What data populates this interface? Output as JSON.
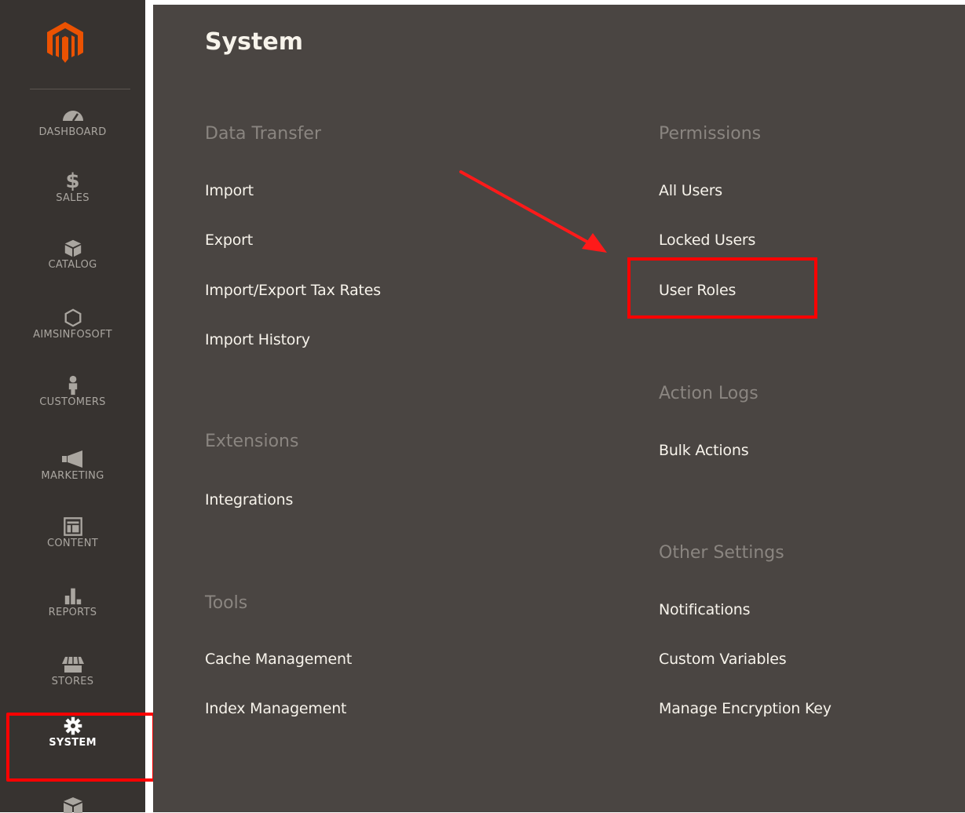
{
  "sidebar": {
    "items": [
      {
        "label": "DASHBOARD",
        "icon": "dashboard-icon"
      },
      {
        "label": "SALES",
        "icon": "dollar-icon"
      },
      {
        "label": "CATALOG",
        "icon": "box-icon"
      },
      {
        "label": "AIMSINFOSOFT",
        "icon": "hexagon-icon"
      },
      {
        "label": "CUSTOMERS",
        "icon": "person-icon"
      },
      {
        "label": "MARKETING",
        "icon": "megaphone-icon"
      },
      {
        "label": "CONTENT",
        "icon": "layout-icon"
      },
      {
        "label": "REPORTS",
        "icon": "bar-chart-icon"
      },
      {
        "label": "STORES",
        "icon": "store-icon"
      },
      {
        "label": "SYSTEM",
        "icon": "gear-icon"
      }
    ],
    "active": "SYSTEM"
  },
  "panel": {
    "title": "System",
    "left_groups": [
      {
        "title": "Data Transfer",
        "links": [
          "Import",
          "Export",
          "Import/Export Tax Rates",
          "Import History"
        ]
      },
      {
        "title": "Extensions",
        "links": [
          "Integrations"
        ]
      },
      {
        "title": "Tools",
        "links": [
          "Cache Management",
          "Index Management"
        ]
      }
    ],
    "right_groups": [
      {
        "title": "Permissions",
        "links": [
          "All Users",
          "Locked Users",
          "User Roles"
        ]
      },
      {
        "title": "Action Logs",
        "links": [
          "Bulk Actions"
        ]
      },
      {
        "title": "Other Settings",
        "links": [
          "Notifications",
          "Custom Variables",
          "Manage Encryption Key"
        ]
      }
    ]
  },
  "colors": {
    "sidebar_bg": "#373330",
    "panel_bg": "#4a4542",
    "highlight": "#ff0000",
    "logo": "#eb5202"
  }
}
